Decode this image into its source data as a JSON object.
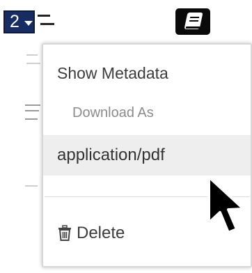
{
  "toolbar": {
    "version_number": "2"
  },
  "menu": {
    "show_metadata": "Show Metadata",
    "download_as": "Download As",
    "download_option": "application/pdf",
    "delete": "Delete"
  },
  "icons": {
    "version_caret": "caret-down-icon",
    "notes": "notebook-icon",
    "trash": "trash-icon",
    "cursor": "mouse-pointer-icon"
  },
  "colors": {
    "version_badge": "#172c63",
    "hover_row": "#eeeeee"
  }
}
